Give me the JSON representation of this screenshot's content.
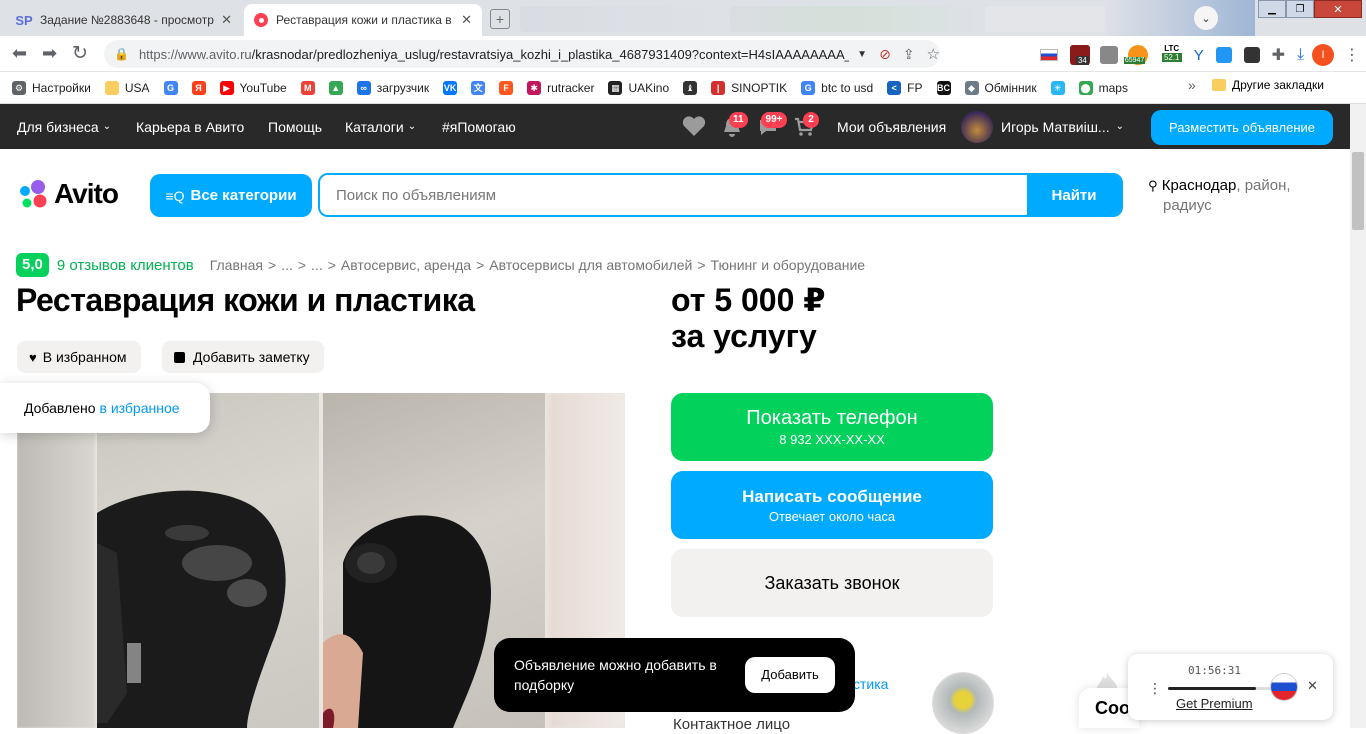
{
  "browser": {
    "tabs": [
      {
        "title": "Задание №2883648 - просмотр з",
        "favicon": "SP",
        "active": false
      },
      {
        "title": "Реставрация кожи и пластика в К",
        "favicon": "avito",
        "active": true
      }
    ],
    "url_host": "https://www.avito.ru",
    "url_path": "/krasnodar/predlozheniya_uslug/restavratsiya_kozhi_i_plastika_4687931409?context=H4sIAAAAAAAA_wE_...",
    "ext_badges": {
      "ext1": "34",
      "ext2": "65947",
      "ltc_label": "LTC",
      "ltc_value": "52.1"
    },
    "profile_initial": "I",
    "bookmarks": [
      {
        "label": "Настройки",
        "icon": "gear-icon"
      },
      {
        "label": "USA",
        "icon": "folder-icon"
      },
      {
        "label": "",
        "icon": "google-icon"
      },
      {
        "label": "",
        "icon": "yandex-icon"
      },
      {
        "label": "YouTube",
        "icon": "youtube-icon"
      },
      {
        "label": "",
        "icon": "gmail-icon"
      },
      {
        "label": "",
        "icon": "drive-icon"
      },
      {
        "label": "загрузчик",
        "icon": "loop-icon"
      },
      {
        "label": "",
        "icon": "vk-icon"
      },
      {
        "label": "",
        "icon": "translate-icon"
      },
      {
        "label": "",
        "icon": "f-icon"
      },
      {
        "label": "rutracker",
        "icon": "rutracker-icon"
      },
      {
        "label": "UAKino",
        "icon": "uakino-icon"
      },
      {
        "label": "",
        "icon": "chess-icon"
      },
      {
        "label": "SINOPTIK",
        "icon": "thermometer-icon"
      },
      {
        "label": "btc to usd",
        "icon": "google-icon"
      },
      {
        "label": "FP",
        "icon": "fp-icon"
      },
      {
        "label": "",
        "icon": "bc-icon"
      },
      {
        "label": "Обмінник",
        "icon": "exchange-icon"
      },
      {
        "label": "",
        "icon": "snowflake-icon"
      },
      {
        "label": "maps",
        "icon": "maps-icon"
      }
    ],
    "more_bookmarks": "»",
    "other_bookmarks": "Другие закладки"
  },
  "topbar": {
    "for_business": "Для бизнеса",
    "career": "Карьера в Авито",
    "help": "Помощь",
    "catalogs": "Каталоги",
    "ihelp": "#яПомогаю",
    "notif_count": "11",
    "msg_count": "99+",
    "cart_count": "2",
    "my_ads": "Мои объявления",
    "user_name": "Игорь Матвиiш...",
    "post_ad": "Разместить объявление"
  },
  "header": {
    "logo": "Avito",
    "all_categories": "Все категории",
    "search_placeholder": "Поиск по объявлениям",
    "find": "Найти",
    "city": "Краснодар",
    "city_extra": ", район,",
    "radius": "радиус"
  },
  "breadcrumbs": {
    "rating": "5,0",
    "reviews": "9 отзывов клиентов",
    "items": [
      "Главная",
      "...",
      "...",
      "Автосервис, аренда",
      "Автосервисы для автомобилей",
      "Тюнинг и оборудование"
    ],
    "sep": ">"
  },
  "listing": {
    "title": "Реставрация кожи и пластика",
    "price_line1": "от 5 000 ₽",
    "price_line2": "за услугу",
    "favorite_btn": "В избранном",
    "note_btn": "Добавить заметку",
    "fav_toast_text": "Добавлено",
    "fav_toast_link": "в избранное"
  },
  "actions": {
    "show_phone": "Показать телефон",
    "phone_masked": "8 932 XXX-XX-XX",
    "write_message": "Написать сообщение",
    "reply_time": "Отвечает около часа",
    "order_call": "Заказать звонок"
  },
  "seller": {
    "name_fragment": "стика",
    "sub_fragment": "в",
    "contact": "Контактное лицо"
  },
  "toast": {
    "text": "Объявление можно добавить в подборку",
    "button": "Добавить"
  },
  "premium_widget": {
    "timer": "01:56:31",
    "link": "Get Premium",
    "progress": 0.8
  },
  "side_peek": "Соо",
  "colors": {
    "avito_blue": "#00aaff",
    "avito_green": "#02d15c",
    "topbar_bg": "#292929",
    "badge_red": "#ff4053"
  }
}
